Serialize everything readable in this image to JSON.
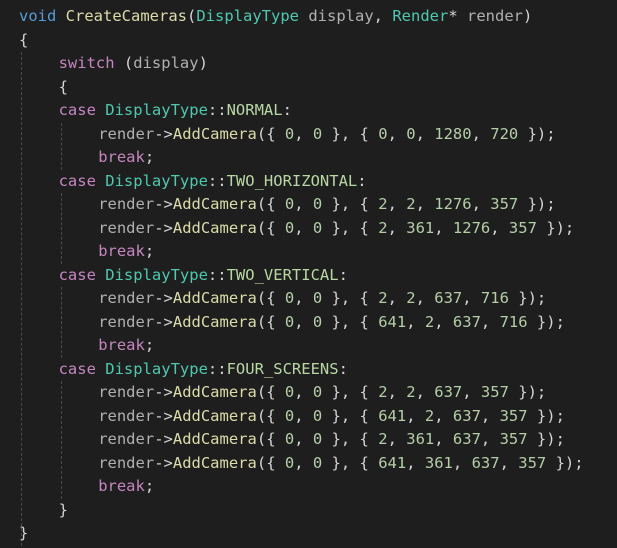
{
  "editor": {
    "colors": {
      "background": "#1e1e1e",
      "keyword": "#569cd6",
      "control": "#c586c0",
      "type": "#4ec9b0",
      "function": "#dcdcaa",
      "variable": "#9cdcfe",
      "number": "#b5cea8",
      "enum_member": "#b8d7a3",
      "punctuation": "#d4d4d4"
    },
    "lines": [
      {
        "indent": 0,
        "tokens": [
          {
            "t": "void",
            "k": "keyword"
          },
          {
            "t": " ",
            "k": "punct"
          },
          {
            "t": "CreateCameras",
            "k": "func"
          },
          {
            "t": "(",
            "k": "punct"
          },
          {
            "t": "DisplayType",
            "k": "type"
          },
          {
            "t": " ",
            "k": "punct"
          },
          {
            "t": "display",
            "k": "grey"
          },
          {
            "t": ", ",
            "k": "punct"
          },
          {
            "t": "Render",
            "k": "type"
          },
          {
            "t": "* ",
            "k": "punct"
          },
          {
            "t": "render",
            "k": "grey"
          },
          {
            "t": ")",
            "k": "punct"
          }
        ]
      },
      {
        "indent": 0,
        "tokens": [
          {
            "t": "{",
            "k": "punct"
          }
        ]
      },
      {
        "indent": 1,
        "tokens": [
          {
            "t": "switch",
            "k": "control"
          },
          {
            "t": " (",
            "k": "punct"
          },
          {
            "t": "display",
            "k": "grey"
          },
          {
            "t": ")",
            "k": "punct"
          }
        ]
      },
      {
        "indent": 1,
        "tokens": [
          {
            "t": "{",
            "k": "punct"
          }
        ]
      },
      {
        "indent": 1,
        "tokens": [
          {
            "t": "case",
            "k": "control"
          },
          {
            "t": " ",
            "k": "punct"
          },
          {
            "t": "DisplayType",
            "k": "type"
          },
          {
            "t": "::",
            "k": "punct"
          },
          {
            "t": "NORMAL",
            "k": "enum"
          },
          {
            "t": ":",
            "k": "punct"
          }
        ]
      },
      {
        "indent": 2,
        "tokens": [
          {
            "t": "render",
            "k": "grey"
          },
          {
            "t": "->",
            "k": "punct"
          },
          {
            "t": "AddCamera",
            "k": "func"
          },
          {
            "t": "({ ",
            "k": "punct"
          },
          {
            "t": "0",
            "k": "num"
          },
          {
            "t": ", ",
            "k": "punct"
          },
          {
            "t": "0",
            "k": "num"
          },
          {
            "t": " }, { ",
            "k": "punct"
          },
          {
            "t": "0",
            "k": "num"
          },
          {
            "t": ", ",
            "k": "punct"
          },
          {
            "t": "0",
            "k": "num"
          },
          {
            "t": ", ",
            "k": "punct"
          },
          {
            "t": "1280",
            "k": "num"
          },
          {
            "t": ", ",
            "k": "punct"
          },
          {
            "t": "720",
            "k": "num"
          },
          {
            "t": " });",
            "k": "punct"
          }
        ]
      },
      {
        "indent": 2,
        "tokens": [
          {
            "t": "break",
            "k": "control"
          },
          {
            "t": ";",
            "k": "punct"
          }
        ]
      },
      {
        "indent": 1,
        "tokens": [
          {
            "t": "case",
            "k": "control"
          },
          {
            "t": " ",
            "k": "punct"
          },
          {
            "t": "DisplayType",
            "k": "type"
          },
          {
            "t": "::",
            "k": "punct"
          },
          {
            "t": "TWO_HORIZONTAL",
            "k": "enum"
          },
          {
            "t": ":",
            "k": "punct"
          }
        ]
      },
      {
        "indent": 2,
        "tokens": [
          {
            "t": "render",
            "k": "grey"
          },
          {
            "t": "->",
            "k": "punct"
          },
          {
            "t": "AddCamera",
            "k": "func"
          },
          {
            "t": "({ ",
            "k": "punct"
          },
          {
            "t": "0",
            "k": "num"
          },
          {
            "t": ", ",
            "k": "punct"
          },
          {
            "t": "0",
            "k": "num"
          },
          {
            "t": " }, { ",
            "k": "punct"
          },
          {
            "t": "2",
            "k": "num"
          },
          {
            "t": ", ",
            "k": "punct"
          },
          {
            "t": "2",
            "k": "num"
          },
          {
            "t": ", ",
            "k": "punct"
          },
          {
            "t": "1276",
            "k": "num"
          },
          {
            "t": ", ",
            "k": "punct"
          },
          {
            "t": "357",
            "k": "num"
          },
          {
            "t": " });",
            "k": "punct"
          }
        ]
      },
      {
        "indent": 2,
        "tokens": [
          {
            "t": "render",
            "k": "grey"
          },
          {
            "t": "->",
            "k": "punct"
          },
          {
            "t": "AddCamera",
            "k": "func"
          },
          {
            "t": "({ ",
            "k": "punct"
          },
          {
            "t": "0",
            "k": "num"
          },
          {
            "t": ", ",
            "k": "punct"
          },
          {
            "t": "0",
            "k": "num"
          },
          {
            "t": " }, { ",
            "k": "punct"
          },
          {
            "t": "2",
            "k": "num"
          },
          {
            "t": ", ",
            "k": "punct"
          },
          {
            "t": "361",
            "k": "num"
          },
          {
            "t": ", ",
            "k": "punct"
          },
          {
            "t": "1276",
            "k": "num"
          },
          {
            "t": ", ",
            "k": "punct"
          },
          {
            "t": "357",
            "k": "num"
          },
          {
            "t": " });",
            "k": "punct"
          }
        ]
      },
      {
        "indent": 2,
        "tokens": [
          {
            "t": "break",
            "k": "control"
          },
          {
            "t": ";",
            "k": "punct"
          }
        ]
      },
      {
        "indent": 1,
        "tokens": [
          {
            "t": "case",
            "k": "control"
          },
          {
            "t": " ",
            "k": "punct"
          },
          {
            "t": "DisplayType",
            "k": "type"
          },
          {
            "t": "::",
            "k": "punct"
          },
          {
            "t": "TWO_VERTICAL",
            "k": "enum"
          },
          {
            "t": ":",
            "k": "punct"
          }
        ]
      },
      {
        "indent": 2,
        "tokens": [
          {
            "t": "render",
            "k": "grey"
          },
          {
            "t": "->",
            "k": "punct"
          },
          {
            "t": "AddCamera",
            "k": "func"
          },
          {
            "t": "({ ",
            "k": "punct"
          },
          {
            "t": "0",
            "k": "num"
          },
          {
            "t": ", ",
            "k": "punct"
          },
          {
            "t": "0",
            "k": "num"
          },
          {
            "t": " }, { ",
            "k": "punct"
          },
          {
            "t": "2",
            "k": "num"
          },
          {
            "t": ", ",
            "k": "punct"
          },
          {
            "t": "2",
            "k": "num"
          },
          {
            "t": ", ",
            "k": "punct"
          },
          {
            "t": "637",
            "k": "num"
          },
          {
            "t": ", ",
            "k": "punct"
          },
          {
            "t": "716",
            "k": "num"
          },
          {
            "t": " });",
            "k": "punct"
          }
        ]
      },
      {
        "indent": 2,
        "tokens": [
          {
            "t": "render",
            "k": "grey"
          },
          {
            "t": "->",
            "k": "punct"
          },
          {
            "t": "AddCamera",
            "k": "func"
          },
          {
            "t": "({ ",
            "k": "punct"
          },
          {
            "t": "0",
            "k": "num"
          },
          {
            "t": ", ",
            "k": "punct"
          },
          {
            "t": "0",
            "k": "num"
          },
          {
            "t": " }, { ",
            "k": "punct"
          },
          {
            "t": "641",
            "k": "num"
          },
          {
            "t": ", ",
            "k": "punct"
          },
          {
            "t": "2",
            "k": "num"
          },
          {
            "t": ", ",
            "k": "punct"
          },
          {
            "t": "637",
            "k": "num"
          },
          {
            "t": ", ",
            "k": "punct"
          },
          {
            "t": "716",
            "k": "num"
          },
          {
            "t": " });",
            "k": "punct"
          }
        ]
      },
      {
        "indent": 2,
        "tokens": [
          {
            "t": "break",
            "k": "control"
          },
          {
            "t": ";",
            "k": "punct"
          }
        ]
      },
      {
        "indent": 1,
        "tokens": [
          {
            "t": "case",
            "k": "control"
          },
          {
            "t": " ",
            "k": "punct"
          },
          {
            "t": "DisplayType",
            "k": "type"
          },
          {
            "t": "::",
            "k": "punct"
          },
          {
            "t": "FOUR_SCREENS",
            "k": "enum"
          },
          {
            "t": ":",
            "k": "punct"
          }
        ]
      },
      {
        "indent": 2,
        "tokens": [
          {
            "t": "render",
            "k": "grey"
          },
          {
            "t": "->",
            "k": "punct"
          },
          {
            "t": "AddCamera",
            "k": "func"
          },
          {
            "t": "({ ",
            "k": "punct"
          },
          {
            "t": "0",
            "k": "num"
          },
          {
            "t": ", ",
            "k": "punct"
          },
          {
            "t": "0",
            "k": "num"
          },
          {
            "t": " }, { ",
            "k": "punct"
          },
          {
            "t": "2",
            "k": "num"
          },
          {
            "t": ", ",
            "k": "punct"
          },
          {
            "t": "2",
            "k": "num"
          },
          {
            "t": ", ",
            "k": "punct"
          },
          {
            "t": "637",
            "k": "num"
          },
          {
            "t": ", ",
            "k": "punct"
          },
          {
            "t": "357",
            "k": "num"
          },
          {
            "t": " });",
            "k": "punct"
          }
        ]
      },
      {
        "indent": 2,
        "tokens": [
          {
            "t": "render",
            "k": "grey"
          },
          {
            "t": "->",
            "k": "punct"
          },
          {
            "t": "AddCamera",
            "k": "func"
          },
          {
            "t": "({ ",
            "k": "punct"
          },
          {
            "t": "0",
            "k": "num"
          },
          {
            "t": ", ",
            "k": "punct"
          },
          {
            "t": "0",
            "k": "num"
          },
          {
            "t": " }, { ",
            "k": "punct"
          },
          {
            "t": "641",
            "k": "num"
          },
          {
            "t": ", ",
            "k": "punct"
          },
          {
            "t": "2",
            "k": "num"
          },
          {
            "t": ", ",
            "k": "punct"
          },
          {
            "t": "637",
            "k": "num"
          },
          {
            "t": ", ",
            "k": "punct"
          },
          {
            "t": "357",
            "k": "num"
          },
          {
            "t": " });",
            "k": "punct"
          }
        ]
      },
      {
        "indent": 2,
        "tokens": [
          {
            "t": "render",
            "k": "grey"
          },
          {
            "t": "->",
            "k": "punct"
          },
          {
            "t": "AddCamera",
            "k": "func"
          },
          {
            "t": "({ ",
            "k": "punct"
          },
          {
            "t": "0",
            "k": "num"
          },
          {
            "t": ", ",
            "k": "punct"
          },
          {
            "t": "0",
            "k": "num"
          },
          {
            "t": " }, { ",
            "k": "punct"
          },
          {
            "t": "2",
            "k": "num"
          },
          {
            "t": ", ",
            "k": "punct"
          },
          {
            "t": "361",
            "k": "num"
          },
          {
            "t": ", ",
            "k": "punct"
          },
          {
            "t": "637",
            "k": "num"
          },
          {
            "t": ", ",
            "k": "punct"
          },
          {
            "t": "357",
            "k": "num"
          },
          {
            "t": " });",
            "k": "punct"
          }
        ]
      },
      {
        "indent": 2,
        "tokens": [
          {
            "t": "render",
            "k": "grey"
          },
          {
            "t": "->",
            "k": "punct"
          },
          {
            "t": "AddCamera",
            "k": "func"
          },
          {
            "t": "({ ",
            "k": "punct"
          },
          {
            "t": "0",
            "k": "num"
          },
          {
            "t": ", ",
            "k": "punct"
          },
          {
            "t": "0",
            "k": "num"
          },
          {
            "t": " }, { ",
            "k": "punct"
          },
          {
            "t": "641",
            "k": "num"
          },
          {
            "t": ", ",
            "k": "punct"
          },
          {
            "t": "361",
            "k": "num"
          },
          {
            "t": ", ",
            "k": "punct"
          },
          {
            "t": "637",
            "k": "num"
          },
          {
            "t": ", ",
            "k": "punct"
          },
          {
            "t": "357",
            "k": "num"
          },
          {
            "t": " });",
            "k": "punct"
          }
        ]
      },
      {
        "indent": 2,
        "tokens": [
          {
            "t": "break",
            "k": "control"
          },
          {
            "t": ";",
            "k": "punct"
          }
        ]
      },
      {
        "indent": 1,
        "tokens": [
          {
            "t": "}",
            "k": "punct"
          }
        ]
      },
      {
        "indent": 0,
        "tokens": [
          {
            "t": "}",
            "k": "punct"
          }
        ]
      }
    ]
  }
}
